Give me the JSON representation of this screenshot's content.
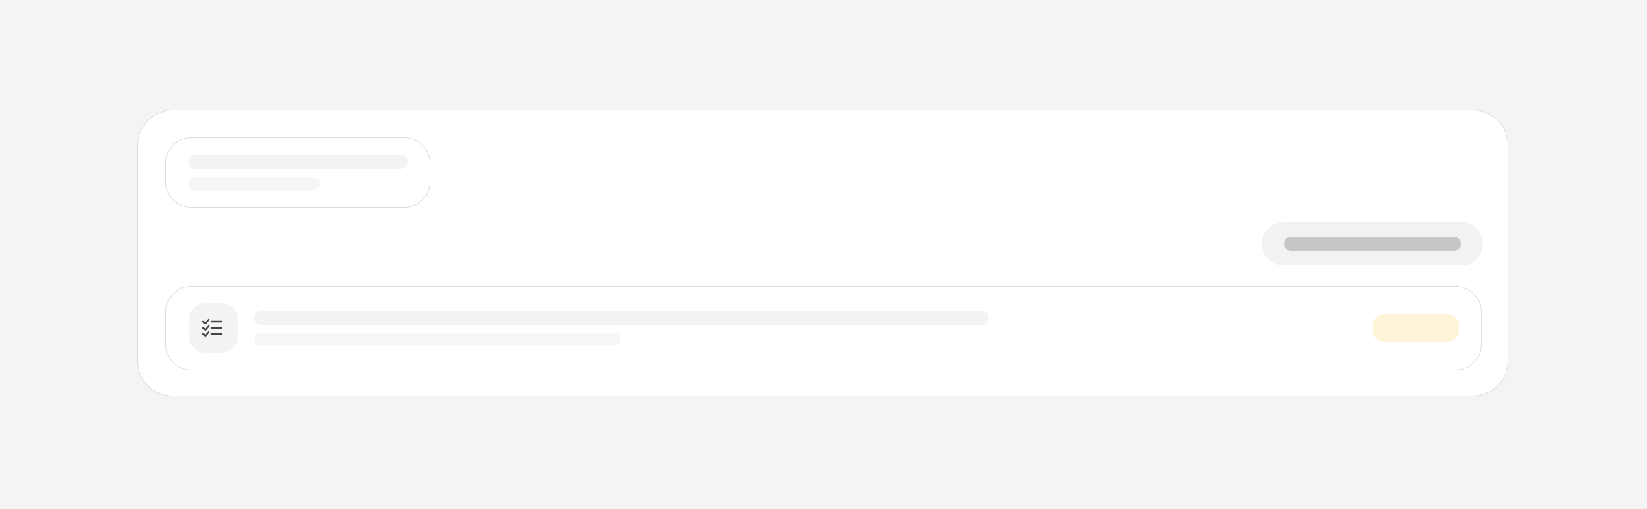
{
  "header": {
    "title": "",
    "subtitle": ""
  },
  "action_button": {
    "label": ""
  },
  "task_item": {
    "icon": "checklist-icon",
    "title": "",
    "description": "",
    "status": ""
  },
  "colors": {
    "page_background": "#f4f4f4",
    "card_background": "#ffffff",
    "border": "#dcdcdc",
    "skeleton_light": "#f3f3f3",
    "button_background": "#f2f2f2",
    "button_bar": "#c6c6c6",
    "badge_background": "#fff3d8",
    "icon_stroke": "#444444"
  }
}
